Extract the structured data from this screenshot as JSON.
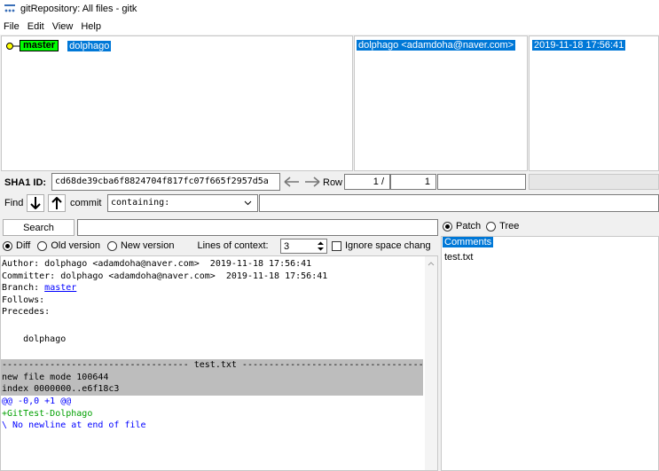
{
  "window": {
    "title": "gitRepository: All files - gitk"
  },
  "menu": [
    "File",
    "Edit",
    "View",
    "Help"
  ],
  "commit_list": {
    "branch_label": "master",
    "commit_message": "dolphago",
    "author": "dolphago <adamdoha@naver.com>",
    "date": "2019-11-18 17:56:41"
  },
  "sha_bar": {
    "label": "SHA1 ID:",
    "sha": "cd68de39cba6f8824704f817fc07f665f2957d5a",
    "row_label": "Row",
    "row_current": "1 /",
    "row_total": "1"
  },
  "find_bar": {
    "label": "Find",
    "commit_label": "commit",
    "mode": "containing:"
  },
  "search": {
    "button": "Search",
    "value": ""
  },
  "diff_options": {
    "diff": "Diff",
    "old_version": "Old version",
    "new_version": "New version",
    "lines_of_context_label": "Lines of context:",
    "lines_of_context": "3",
    "ignore_space": "Ignore space chang"
  },
  "view_toggle": {
    "patch": "Patch",
    "tree": "Tree"
  },
  "file_list": {
    "comments": "Comments",
    "files": [
      "test.txt"
    ]
  },
  "details": {
    "author_line": "Author: dolphago <adamdoha@naver.com>  2019-11-18 17:56:41",
    "committer_line": "Committer: dolphago <adamdoha@naver.com>  2019-11-18 17:56:41",
    "branch_prefix": "Branch: ",
    "branch_link": "master",
    "follows": "Follows:",
    "precedes": "Precedes:",
    "message": "    dolphago",
    "file_header": "----------------------------------- test.txt -----------------------------------",
    "new_file_mode": "new file mode 100644",
    "index_line": "index 0000000..e6f18c3",
    "hunk": "@@ -0,0 +1 @@",
    "added_line": "+GitTest-Dolphago",
    "no_newline": "\\ No newline at end of file"
  },
  "colors": {
    "selection": "#0078d7",
    "branch_tag": "#00ff00",
    "hunk": "#0000ff",
    "added": "#00a000",
    "file_header_bg": "#bdbdbd"
  }
}
